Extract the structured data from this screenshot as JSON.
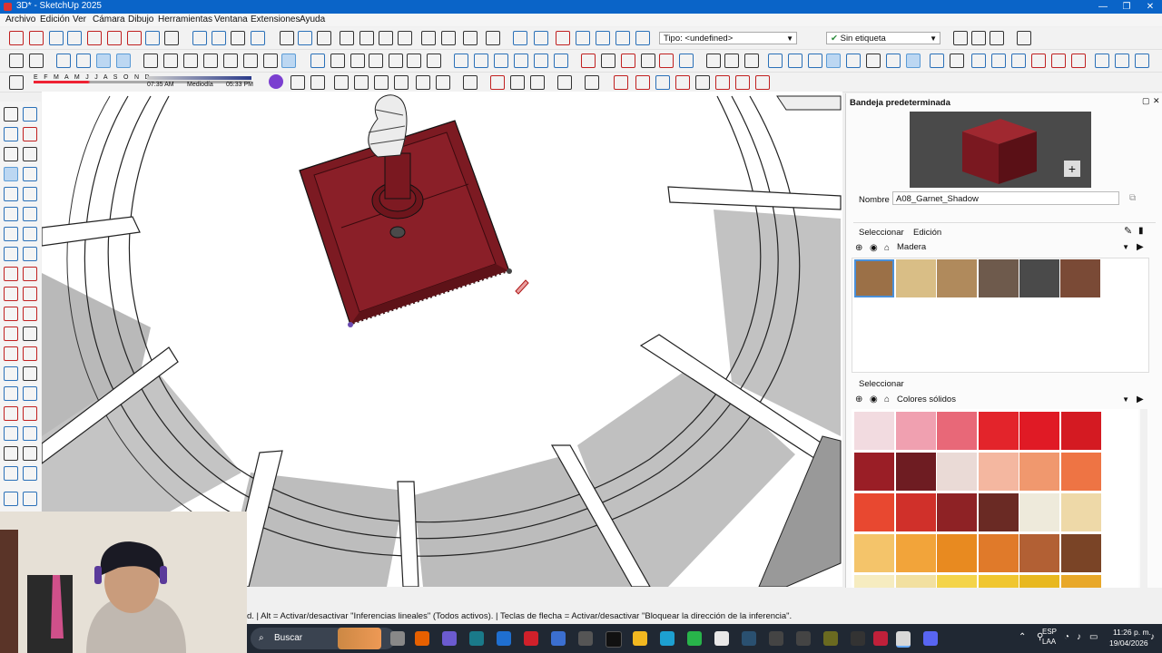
{
  "window": {
    "title": "3D* - SketchUp 2025"
  },
  "menu": [
    "Archivo",
    "Edición",
    "Ver",
    "Cámara",
    "Dibujo",
    "Herramientas",
    "Ventana",
    "Extensiones",
    "Ayuda"
  ],
  "toolbar": {
    "tag_type": "Tipo: <undefined>",
    "tag_filter": "Sin etiqueta"
  },
  "shadows": {
    "months": "E F M A M J J A S O N D",
    "time_start": "07:35 AM",
    "time_mid": "Mediodía",
    "time_end": "05:33 PM"
  },
  "tray": {
    "title": "Bandeja predeterminada",
    "name_label": "Nombre",
    "material_name": "A08_Garnet_Shadow",
    "tab_select": "Seleccionar",
    "tab_edit": "Edición",
    "library_top": "Madera",
    "select_label_2": "Seleccionar",
    "library_bottom": "Colores sólidos",
    "preview_color": "#8a1c24",
    "wood_swatches": [
      "#9b7047",
      "#d9be86",
      "#b08a5c",
      "#6e5a4c",
      "#4a4a4a",
      "#7a4a36"
    ],
    "solid_swatches": [
      "#f2dbe0",
      "#f0a0b0",
      "#e86878",
      "#e3242b",
      "#e01a25",
      "#d41a22",
      "#9a1e26",
      "#6e1c22",
      "#eadad6",
      "#f4b7a0",
      "#f0986e",
      "#ee7444",
      "#e84830",
      "#d0302a",
      "#8e2225",
      "#6a2a24",
      "#eeeadb",
      "#eed9a8",
      "#f4c46a",
      "#f2a43a",
      "#e88a20",
      "#e07a2a",
      "#b26034",
      "#7a4426",
      "#f6ecc0",
      "#f2e0a0",
      "#f4d44a",
      "#f0c630",
      "#e8b820",
      "#e8a82a"
    ]
  },
  "statusbar": {
    "text": "d. | Alt = Activar/desactivar \"Inferencias lineales\" (Todos activos). | Teclas de flecha = Activar/desactivar \"Bloquear la dirección de la inferencia\"."
  },
  "taskbar": {
    "search": "Buscar",
    "lang": "ESP",
    "layout": "LAA",
    "time": "11:26 p. m.",
    "date": "19/04/2026"
  }
}
